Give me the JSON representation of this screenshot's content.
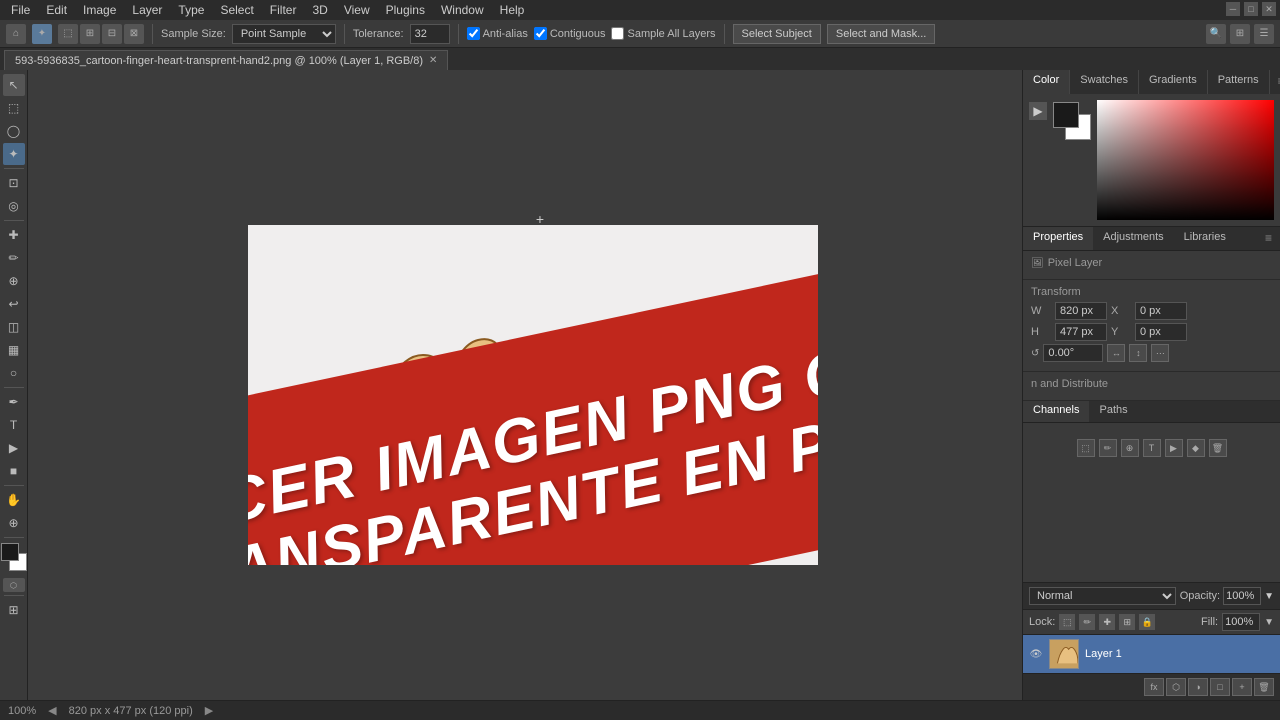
{
  "menubar": {
    "items": [
      "File",
      "Edit",
      "Image",
      "Layer",
      "Type",
      "Select",
      "Filter",
      "3D",
      "View",
      "Plugins",
      "Window",
      "Help"
    ],
    "window_controls": [
      "─",
      "□",
      "✕"
    ]
  },
  "optionsbar": {
    "tool_icons": [
      "arrow",
      "dotted-rect",
      "filled-rect",
      "intersect",
      "subtract"
    ],
    "sample_size_label": "Sample Size:",
    "sample_size_value": "Point Sample",
    "tolerance_label": "Tolerance:",
    "tolerance_value": "32",
    "anti_alias_label": "Anti-alias",
    "anti_alias_checked": true,
    "contiguous_label": "Contiguous",
    "contiguous_checked": true,
    "sample_all_layers_label": "Sample All Layers",
    "sample_all_layers_checked": false,
    "select_subject_btn": "Select Subject",
    "select_mask_btn": "Select and Mask..."
  },
  "tab": {
    "filename": "593-5936835_cartoon-finger-heart-transprent-hand2.png @ 100% (Layer 1, RGB/8)",
    "close": "✕"
  },
  "toolbar_left": {
    "tools": [
      {
        "name": "move",
        "icon": "↖"
      },
      {
        "name": "select-rect",
        "icon": "⬚"
      },
      {
        "name": "lasso",
        "icon": "⌒"
      },
      {
        "name": "wand",
        "icon": "✦"
      },
      {
        "name": "crop",
        "icon": "⊡"
      },
      {
        "name": "eyedropper",
        "icon": "🔬"
      },
      {
        "name": "healing",
        "icon": "✚"
      },
      {
        "name": "brush",
        "icon": "✏"
      },
      {
        "name": "clone",
        "icon": "⊕"
      },
      {
        "name": "history-brush",
        "icon": "↩"
      },
      {
        "name": "eraser",
        "icon": "◫"
      },
      {
        "name": "gradient",
        "icon": "▦"
      },
      {
        "name": "dodge",
        "icon": "○"
      },
      {
        "name": "pen",
        "icon": "✒"
      },
      {
        "name": "text",
        "icon": "T"
      },
      {
        "name": "path-select",
        "icon": "▶"
      },
      {
        "name": "shape",
        "icon": "■"
      },
      {
        "name": "hand",
        "icon": "✋"
      },
      {
        "name": "zoom",
        "icon": "⊕"
      }
    ],
    "color_fg": "#1a1a1a",
    "color_bg": "#ffffff"
  },
  "crosshair": {
    "symbol": "+"
  },
  "canvas": {
    "banner_line1": "HACER IMAGEN PNG CON FONDO",
    "banner_line2": "TRANSPARENTE EN PHOTOSHOP"
  },
  "color_panel": {
    "tabs": [
      "Color",
      "Swatches",
      "Gradients",
      "Patterns"
    ],
    "active_tab": "Color"
  },
  "properties_panel": {
    "tabs": [
      "Properties",
      "Adjustments",
      "Libraries"
    ],
    "active_tab": "Properties",
    "section_pixel_layer": "Pixel Layer",
    "section_transform": "Transform",
    "w_label": "W",
    "w_value": "820 px",
    "x_label": "X",
    "x_value": "0 px",
    "h_label": "H",
    "h_value": "477 px",
    "y_label": "Y",
    "y_value": "0 px",
    "angle_value": "0.00°",
    "align_section": "n and Distribute"
  },
  "channels_paths": {
    "tabs": [
      "Channels",
      "Paths"
    ],
    "active_tab": "Channels"
  },
  "layers_panel": {
    "blend_mode": "Normal",
    "opacity_label": "Opacity:",
    "opacity_value": "100%",
    "lock_label": "Lock:",
    "fill_label": "Fill:",
    "fill_value": "100%",
    "layers": [
      {
        "name": "Layer 1",
        "visible": true
      }
    ]
  },
  "statusbar": {
    "zoom": "100%",
    "dimensions": "820 px x 477 px (120 ppi)"
  }
}
